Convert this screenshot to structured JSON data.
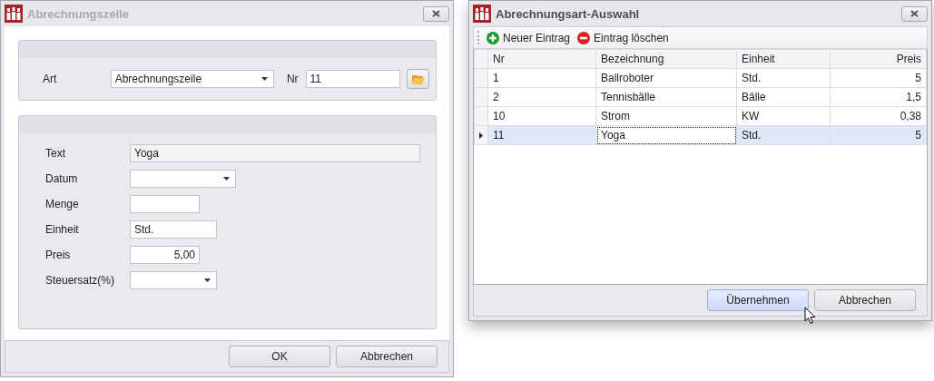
{
  "form_window": {
    "title": "Abrechnungszeile",
    "active": false,
    "art": {
      "label": "Art",
      "value": "Abrechnungszeile"
    },
    "nr": {
      "label": "Nr",
      "value": "11"
    },
    "fields": [
      {
        "label": "Text",
        "kind": "text",
        "value": "Yoga",
        "readonly": true
      },
      {
        "label": "Datum",
        "kind": "dropdown",
        "readonly": false
      },
      {
        "label": "Menge",
        "kind": "number",
        "readonly": false
      },
      {
        "label": "Einheit",
        "kind": "text",
        "value": "Std.",
        "readonly": false
      },
      {
        "label": "Preis",
        "kind": "number",
        "value": "5,00",
        "readonly": false
      },
      {
        "label": "Steuersatz(%)",
        "kind": "dropdown",
        "readonly": false
      }
    ],
    "buttons": [
      {
        "label": "OK",
        "hovered": false
      },
      {
        "label": "Abbrechen",
        "hovered": false
      }
    ]
  },
  "selection_window": {
    "title": "Abrechnungsart-Auswahl",
    "active": true,
    "toolbar": [
      {
        "label": "Neuer Eintrag",
        "kind": "add"
      },
      {
        "label": "Eintrag löschen",
        "kind": "remove"
      }
    ],
    "columns": [
      "Nr",
      "Bezeichnung",
      "Einheit",
      "Preis"
    ],
    "rows": [
      {
        "selected": false,
        "cells": [
          {
            "text": "1",
            "focused": false
          },
          {
            "text": "Ballroboter",
            "focused": false
          },
          {
            "text": "Std.",
            "focused": false
          },
          {
            "text": "5",
            "focused": false
          }
        ]
      },
      {
        "selected": false,
        "cells": [
          {
            "text": "2",
            "focused": false
          },
          {
            "text": "Tennisbälle",
            "focused": false
          },
          {
            "text": "Bälle",
            "focused": false
          },
          {
            "text": "1,5",
            "focused": false
          }
        ]
      },
      {
        "selected": false,
        "cells": [
          {
            "text": "10",
            "focused": false
          },
          {
            "text": "Strom",
            "focused": false
          },
          {
            "text": "KW",
            "focused": false
          },
          {
            "text": "0,38",
            "focused": false
          }
        ]
      },
      {
        "selected": true,
        "cells": [
          {
            "text": "11",
            "focused": false
          },
          {
            "text": "Yoga",
            "focused": true
          },
          {
            "text": "Std.",
            "focused": false
          },
          {
            "text": "5",
            "focused": false
          }
        ]
      }
    ],
    "buttons": [
      {
        "label": "Übernehmen",
        "hovered": true
      },
      {
        "label": "Abbrechen",
        "hovered": false
      }
    ]
  }
}
